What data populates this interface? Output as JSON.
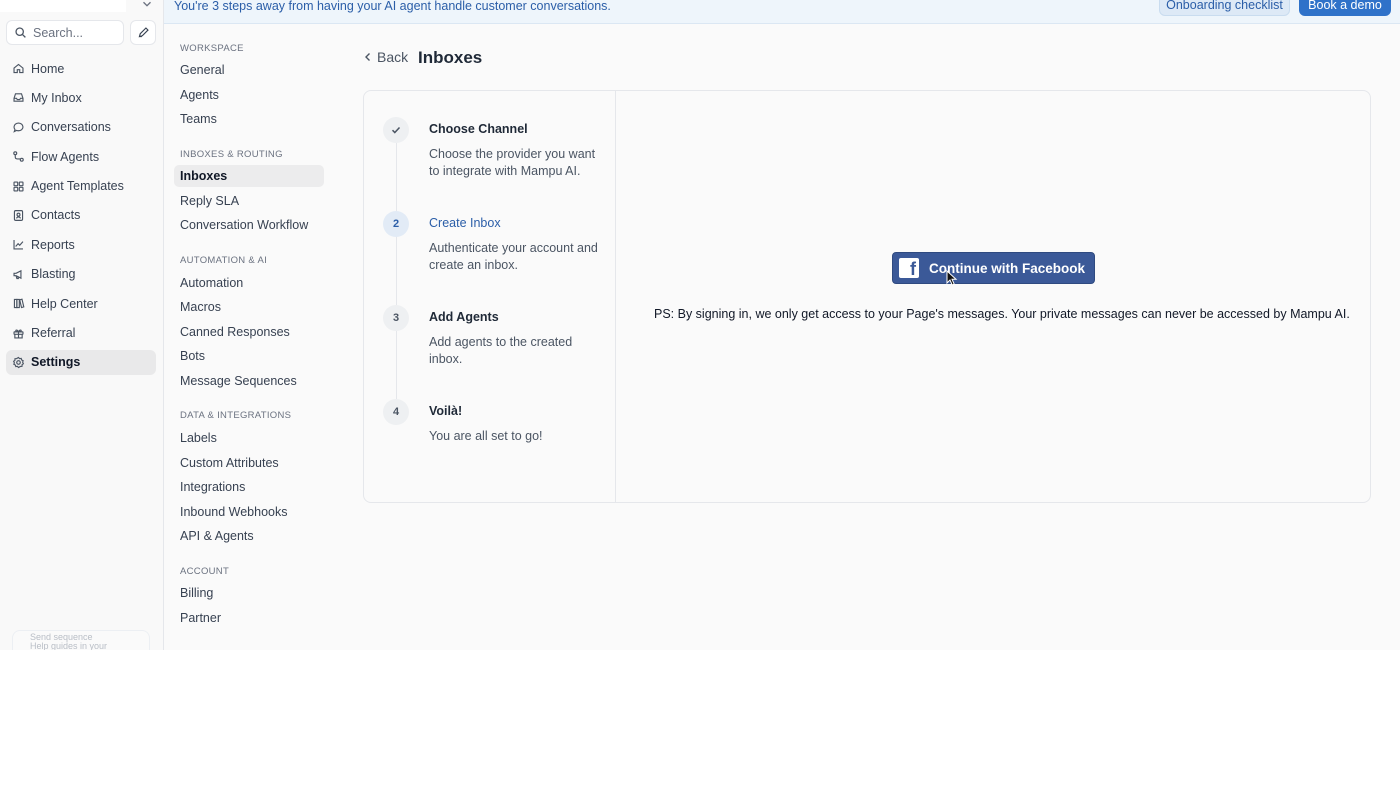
{
  "banner": {
    "message": "You're 3 steps away from having your AI agent handle customer conversations.",
    "checklist_label": "Onboarding checklist",
    "demo_label": "Book a demo"
  },
  "primary_nav": {
    "search_placeholder": "Search...",
    "items": [
      {
        "label": "Home",
        "icon": "home-icon"
      },
      {
        "label": "My Inbox",
        "icon": "inbox-icon"
      },
      {
        "label": "Conversations",
        "icon": "chat-bubble-icon"
      },
      {
        "label": "Flow Agents",
        "icon": "flow-icon"
      },
      {
        "label": "Agent Templates",
        "icon": "grid-icon"
      },
      {
        "label": "Contacts",
        "icon": "contact-card-icon"
      },
      {
        "label": "Reports",
        "icon": "chart-line-icon"
      },
      {
        "label": "Blasting",
        "icon": "megaphone-icon"
      },
      {
        "label": "Help Center",
        "icon": "book-icon"
      },
      {
        "label": "Referral",
        "icon": "gift-icon"
      },
      {
        "label": "Settings",
        "icon": "gear-icon",
        "active": true
      }
    ],
    "bottom_card": {
      "line1": "Send sequence",
      "line2": "Help guides in your"
    }
  },
  "settings_nav": {
    "workspace_heading": "WORKSPACE",
    "workspace_items": [
      "General",
      "Agents",
      "Teams"
    ],
    "inboxes_heading": "INBOXES & ROUTING",
    "inboxes_items": [
      "Inboxes",
      "Reply SLA",
      "Conversation Workflow"
    ],
    "automation_heading": "AUTOMATION & AI",
    "automation_items": [
      "Automation",
      "Macros",
      "Canned Responses",
      "Bots",
      "Message Sequences"
    ],
    "data_heading": "DATA & INTEGRATIONS",
    "data_items": [
      "Labels",
      "Custom Attributes",
      "Integrations",
      "Inbound Webhooks",
      "API & Agents"
    ],
    "account_heading": "ACCOUNT",
    "account_items": [
      "Billing",
      "Partner"
    ],
    "active_item": "Inboxes"
  },
  "main": {
    "back_label": "Back",
    "title": "Inboxes",
    "steps": [
      {
        "number": "",
        "state": "done",
        "title": "Choose Channel",
        "description": "Choose the provider you want to integrate with Mampu AI."
      },
      {
        "number": "2",
        "state": "current",
        "title": "Create Inbox",
        "description": "Authenticate your account and create an inbox."
      },
      {
        "number": "3",
        "state": "pending",
        "title": "Add Agents",
        "description": "Add agents to the created inbox."
      },
      {
        "number": "4",
        "state": "pending",
        "title": "Voilà!",
        "description": "You are all set to go!"
      }
    ],
    "facebook_button_label": "Continue with Facebook",
    "ps_note": "PS: By signing in, we only get access to your Page's messages. Your private messages can never be accessed by Mampu AI."
  },
  "colors": {
    "accent_blue": "#2f72c9",
    "link_blue": "#2b5ea8",
    "facebook_blue": "#3b5998",
    "banner_bg": "#eef5fb"
  }
}
